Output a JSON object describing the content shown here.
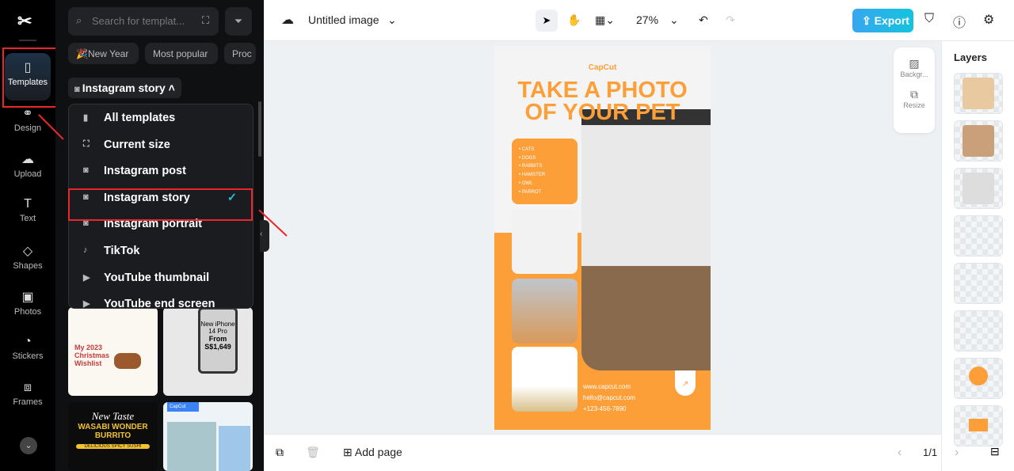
{
  "rail": {
    "items": [
      {
        "label": "Templates",
        "icon": "templates-icon"
      },
      {
        "label": "Design",
        "icon": "design-icon"
      },
      {
        "label": "Upload",
        "icon": "upload-icon"
      },
      {
        "label": "Text",
        "icon": "text-icon"
      },
      {
        "label": "Shapes",
        "icon": "shapes-icon"
      },
      {
        "label": "Photos",
        "icon": "photos-icon"
      },
      {
        "label": "Stickers",
        "icon": "stickers-icon"
      },
      {
        "label": "Frames",
        "icon": "frames-icon"
      }
    ]
  },
  "panel": {
    "search_placeholder": "Search for templat...",
    "chips": [
      "🎉New Year",
      "Most popular",
      "Proc"
    ],
    "category": "Instagram story",
    "menu": [
      "All templates",
      "Current size",
      "Instagram post",
      "Instagram story",
      "Instagram portrait",
      "TikTok",
      "YouTube thumbnail",
      "YouTube end screen"
    ],
    "selected": "Instagram story",
    "thumbs": [
      {
        "title": "My 2023 Christmas Wishlist"
      },
      {
        "title": "New iPhone 14 Pro",
        "price": "From S$1,649"
      },
      {
        "title": "New Taste",
        "subtitle": "WASABI WONDER BURRITO",
        "tag": "DELICIOUS SPICY SUSHI"
      },
      {
        "title": "CapCut"
      }
    ]
  },
  "topbar": {
    "title": "Untitled image",
    "zoom": "27%",
    "export": "Export"
  },
  "tools": {
    "background": "Backgr...",
    "resize": "Resize"
  },
  "layers": {
    "title": "Layers"
  },
  "poster": {
    "brand": "CapCut",
    "headline1": "TAKE A PHOTO",
    "headline2": "OF YOUR PET",
    "list": [
      "CATS",
      "DOGS",
      "RABBITS",
      "HAMSTER",
      "OWL",
      "PARROT"
    ],
    "contacts": [
      "www.capcut.com",
      "hello@capcut.com",
      "+123-456-7890"
    ],
    "accent": "#fd9f38"
  },
  "bottom": {
    "add_page": "Add page",
    "pages": "1/1"
  },
  "colors": {
    "highlight": "#e8262b",
    "accent": "#14c3de"
  }
}
